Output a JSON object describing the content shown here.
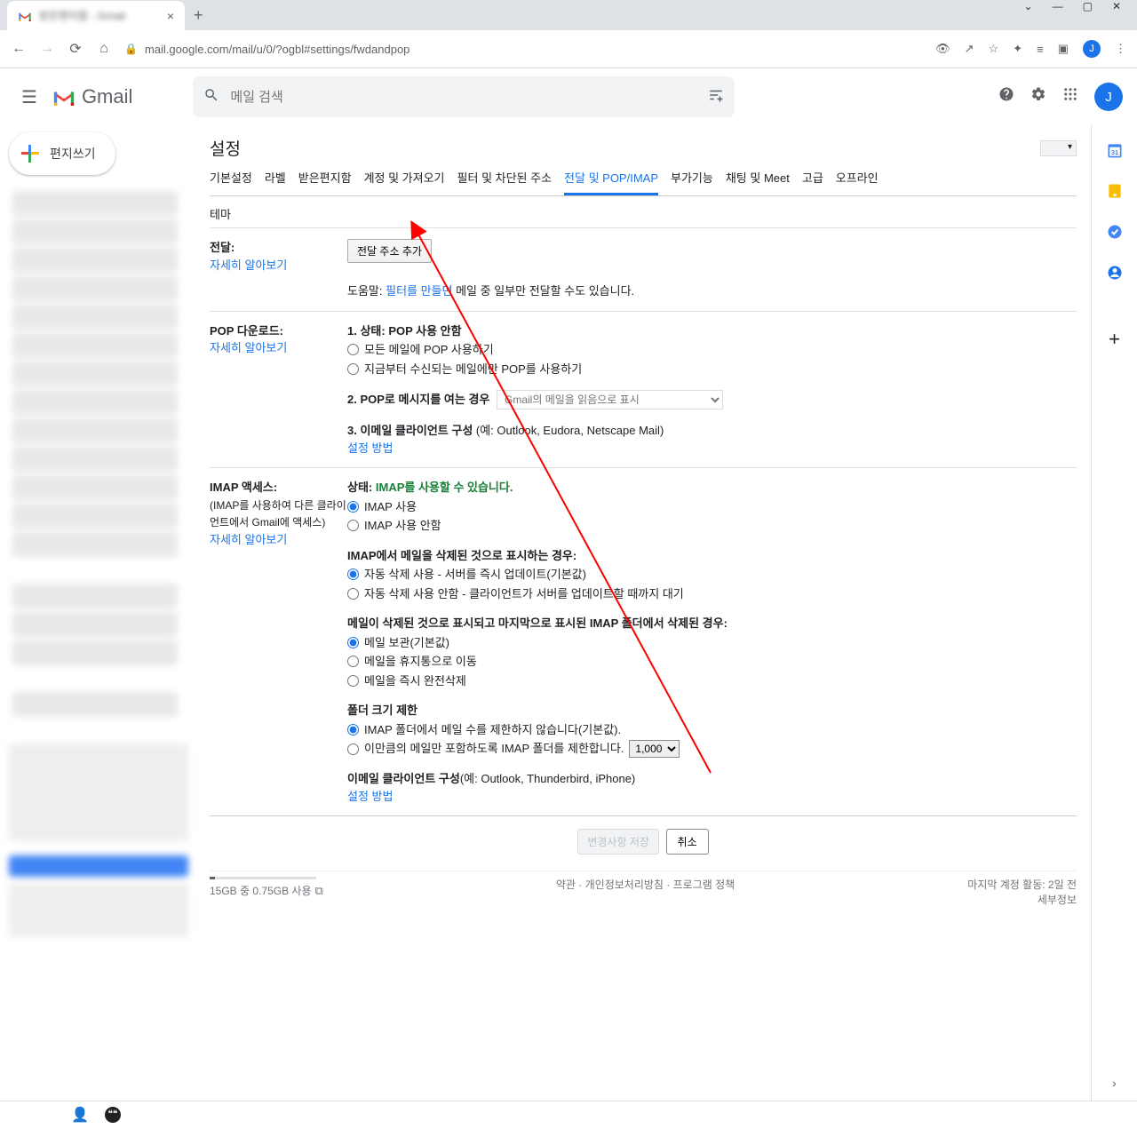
{
  "browser": {
    "url": "mail.google.com/mail/u/0/?ogbl#settings/fwdandpop",
    "avatar_initial": "J"
  },
  "header": {
    "product": "Gmail",
    "search_placeholder": "메일 검색",
    "avatar_initial": "J"
  },
  "compose_label": "편지쓰기",
  "settings": {
    "title": "설정",
    "tabs": [
      "기본설정",
      "라벨",
      "받은편지함",
      "계정 및 가져오기",
      "필터 및 차단된 주소",
      "전달 및 POP/IMAP",
      "부가기능",
      "채팅 및 Meet",
      "고급",
      "오프라인"
    ],
    "tab_theme": "테마",
    "active_tab_index": 5
  },
  "fwd": {
    "label": "전달:",
    "learn": "자세히 알아보기",
    "add_button": "전달 주소 추가",
    "tip_prefix": "도움말: ",
    "tip_link": "필터를 만들면",
    "tip_suffix": " 메일 중 일부만 전달할 수도 있습니다."
  },
  "pop": {
    "label": "POP 다운로드:",
    "learn": "자세히 알아보기",
    "status_head": "1. 상태: POP 사용 안함",
    "opt_all": "모든 메일에 POP 사용하기",
    "opt_new": "지금부터 수신되는 메일에만 POP를 사용하기",
    "open_head": "2. POP로 메시지를 여는 경우",
    "open_select": "Gmail의 메일을 읽음으로 표시",
    "client_head": "3. 이메일 클라이언트 구성 ",
    "client_paren": "(예: Outlook, Eudora, Netscape Mail)",
    "how_link": "설정 방법"
  },
  "imap": {
    "label": "IMAP 액세스:",
    "sub": "(IMAP를 사용하여 다른 클라이언트에서 Gmail에 액세스)",
    "learn": "자세히 알아보기",
    "status_label": "상태: ",
    "status_value": "IMAP를 사용할 수 있습니다.",
    "opt_on": "IMAP 사용",
    "opt_off": "IMAP 사용 안함",
    "del_head": "IMAP에서 메일을 삭제된 것으로 표시하는 경우:",
    "del_opt1": "자동 삭제 사용 - 서버를 즉시 업데이트(기본값)",
    "del_opt2": "자동 삭제 사용 안함 - 클라이언트가 서버를 업데이트할 때까지 대기",
    "last_head": "메일이 삭제된 것으로 표시되고 마지막으로 표시된 IMAP 폴더에서 삭제된 경우:",
    "last_opt1": "메일 보관(기본값)",
    "last_opt2": "메일을 휴지통으로 이동",
    "last_opt3": "메일을 즉시 완전삭제",
    "folder_head": "폴더 크기 제한",
    "folder_opt1": "IMAP 폴더에서 메일 수를 제한하지 않습니다(기본값).",
    "folder_opt2": "이만큼의 메일만 포함하도록 IMAP 폴더를 제한합니다.",
    "folder_limit": "1,000",
    "client_head": "이메일 클라이언트 구성",
    "client_paren": "(예: Outlook, Thunderbird, iPhone)",
    "how_link": "설정 방법"
  },
  "actions": {
    "save": "변경사항 저장",
    "cancel": "취소"
  },
  "footer": {
    "quota_text": "15GB 중 0.75GB 사용",
    "terms": "약관",
    "privacy": "개인정보처리방침",
    "program": "프로그램 정책",
    "activity": "마지막 계정 활동: 2일 전",
    "details": "세부정보"
  }
}
